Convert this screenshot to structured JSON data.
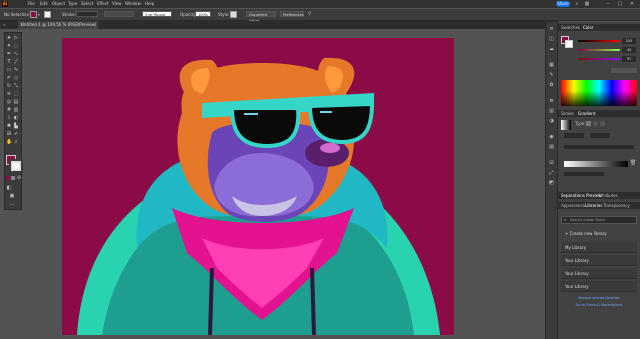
{
  "app": {
    "logo": "Ai"
  },
  "menu": {
    "items": [
      "File",
      "Edit",
      "Object",
      "Type",
      "Select",
      "Effect",
      "View",
      "Window",
      "Help"
    ]
  },
  "topbar": {
    "share_label": "Share"
  },
  "control": {
    "selection_label": "No Selection",
    "stroke_label": "Stroke:",
    "stroke_value": "",
    "brush_value": "5 pt. Round",
    "opacity_label": "Opacity:",
    "opacity_value": "100%",
    "style_label": "Style:",
    "document_setup_label": "Document Setup",
    "preferences_label": "Preferences",
    "fill_color": "#8a0b45"
  },
  "document": {
    "tab_title": "Untitled-1 @ 104.56 % (RGB/Preview)",
    "close_glyph": "×"
  },
  "panels": {
    "top_tabs": [
      "Swatches",
      "Color"
    ],
    "color_values": [
      "255",
      "43",
      "97"
    ],
    "gradient_tabs": [
      "Stroke",
      "Gradient"
    ],
    "gradient_type_label": "Type:",
    "appearance_tabs": [
      "Appearance",
      "Libraries",
      "Transparency"
    ],
    "transform_tabs": [
      "Separations Preview",
      "Attributes"
    ],
    "search_placeholder": "Search Adobe Stock",
    "create_library_label": "+ Create new library",
    "libraries": [
      "My Library",
      "Your Library",
      "Your Library",
      "Your Library"
    ],
    "footer_line1": "Browse shared libraries",
    "footer_line2": "Go to Stock & Marketplace"
  },
  "colors": {
    "artboard": "#8a0b45",
    "accent_blue": "#1473e6",
    "panel_bg": "#424242"
  }
}
